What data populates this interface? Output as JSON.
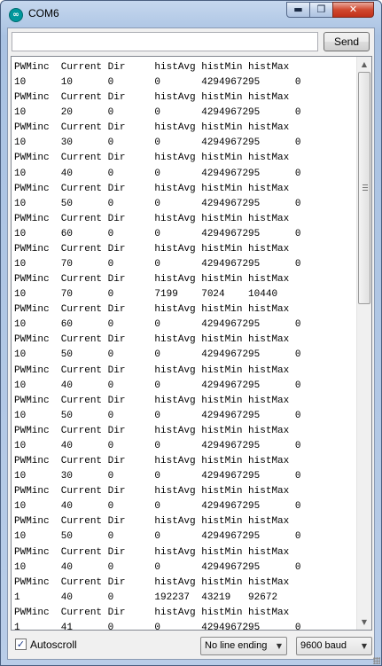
{
  "window": {
    "title": "COM6",
    "icon": "arduino-icon",
    "controls": {
      "minimize": "▬",
      "maximize": "❐",
      "close": "✕"
    }
  },
  "toolbar": {
    "input_value": "",
    "send_label": "Send"
  },
  "serial_output": [
    "PWMinc  Current Dir     histAvg histMin histMax",
    "10      10      0       0       4294967295      0",
    "PWMinc  Current Dir     histAvg histMin histMax",
    "10      20      0       0       4294967295      0",
    "PWMinc  Current Dir     histAvg histMin histMax",
    "10      30      0       0       4294967295      0",
    "PWMinc  Current Dir     histAvg histMin histMax",
    "10      40      0       0       4294967295      0",
    "PWMinc  Current Dir     histAvg histMin histMax",
    "10      50      0       0       4294967295      0",
    "PWMinc  Current Dir     histAvg histMin histMax",
    "10      60      0       0       4294967295      0",
    "PWMinc  Current Dir     histAvg histMin histMax",
    "10      70      0       0       4294967295      0",
    "PWMinc  Current Dir     histAvg histMin histMax",
    "10      70      0       7199    7024    10440",
    "PWMinc  Current Dir     histAvg histMin histMax",
    "10      60      0       0       4294967295      0",
    "PWMinc  Current Dir     histAvg histMin histMax",
    "10      50      0       0       4294967295      0",
    "PWMinc  Current Dir     histAvg histMin histMax",
    "10      40      0       0       4294967295      0",
    "PWMinc  Current Dir     histAvg histMin histMax",
    "10      50      0       0       4294967295      0",
    "PWMinc  Current Dir     histAvg histMin histMax",
    "10      40      0       0       4294967295      0",
    "PWMinc  Current Dir     histAvg histMin histMax",
    "10      30      0       0       4294967295      0",
    "PWMinc  Current Dir     histAvg histMin histMax",
    "10      40      0       0       4294967295      0",
    "PWMinc  Current Dir     histAvg histMin histMax",
    "10      50      0       0       4294967295      0",
    "PWMinc  Current Dir     histAvg histMin histMax",
    "10      40      0       0       4294967295      0",
    "PWMinc  Current Dir     histAvg histMin histMax",
    "1       40      0       192237  43219   92672",
    "PWMinc  Current Dir     histAvg histMin histMax",
    "1       41      0       0       4294967295      0"
  ],
  "footer": {
    "autoscroll_label": "Autoscroll",
    "autoscroll_checked": true,
    "line_ending": "No line ending",
    "baud_rate": "9600 baud"
  }
}
